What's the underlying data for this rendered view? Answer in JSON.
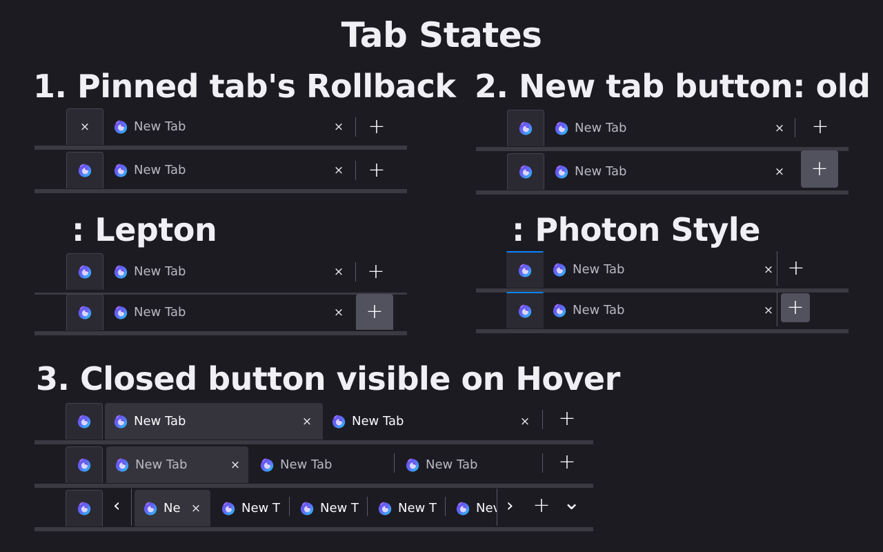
{
  "page_title": "Tab States",
  "sections": {
    "s1": "1. Pinned tab's Rollback",
    "s1b": ": Lepton",
    "s2": "2. New tab button: old",
    "s2b": ": Photon Style",
    "s3": "3. Closed button visible on Hover"
  },
  "tab_label": "New Tab",
  "tab_label_trunc_a": "Ne",
  "tab_label_trunc_b": "New T",
  "tab_label_trunc_c": "Nev",
  "icons": {
    "close": "×",
    "plus": "+",
    "left": "‹",
    "right": "›",
    "down": "⌄",
    "tab_icon": "firefox-logo-icon"
  },
  "colors": {
    "accent_blue": "#0a84ff",
    "background": "#1c1b22",
    "tab_selected": "#35343c"
  }
}
